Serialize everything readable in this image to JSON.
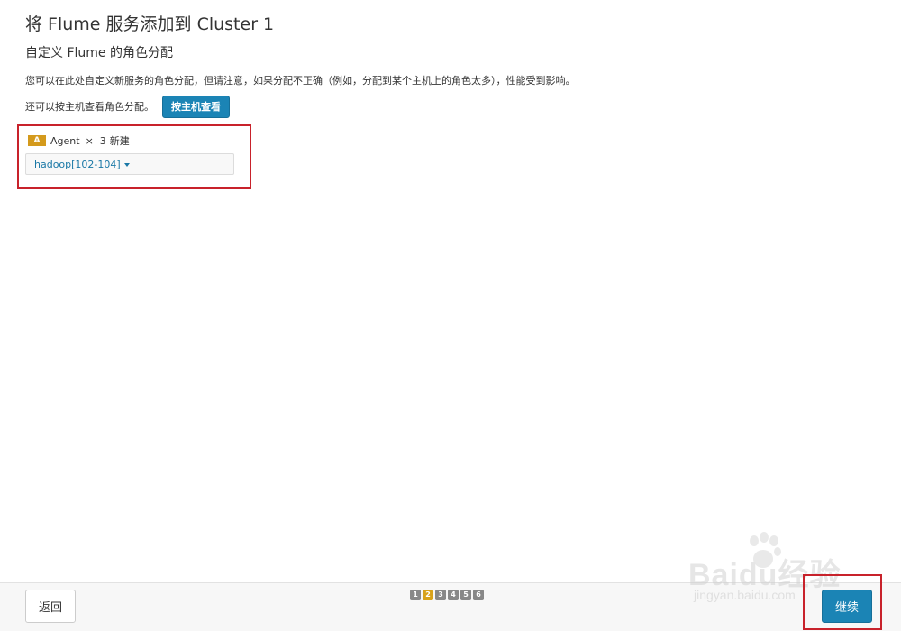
{
  "header": {
    "title": "将 Flume 服务添加到 Cluster 1",
    "subtitle": "自定义 Flume 的角色分配",
    "notice": "您可以在此处自定义新服务的角色分配，但请注意，如果分配不正确（例如，分配到某个主机上的角色太多），性能受到影响。",
    "host_view_text": "还可以按主机查看角色分配。",
    "host_view_button": "按主机查看"
  },
  "role": {
    "badge": "A",
    "name": "Agent",
    "times": "×",
    "count": "3",
    "status": "新建",
    "hosts": "hadoop[102-104]",
    "badge_color": "#d49a1c"
  },
  "footer": {
    "back_label": "返回",
    "continue_label": "继续",
    "steps": [
      "1",
      "2",
      "3",
      "4",
      "5",
      "6"
    ],
    "active_step": "2"
  },
  "watermark": {
    "brand": "Baidu经验",
    "url": "jingyan.baidu.com"
  },
  "colors": {
    "primary": "#1b84b5",
    "highlight": "#c8222b",
    "active_step": "#d8a21a"
  }
}
